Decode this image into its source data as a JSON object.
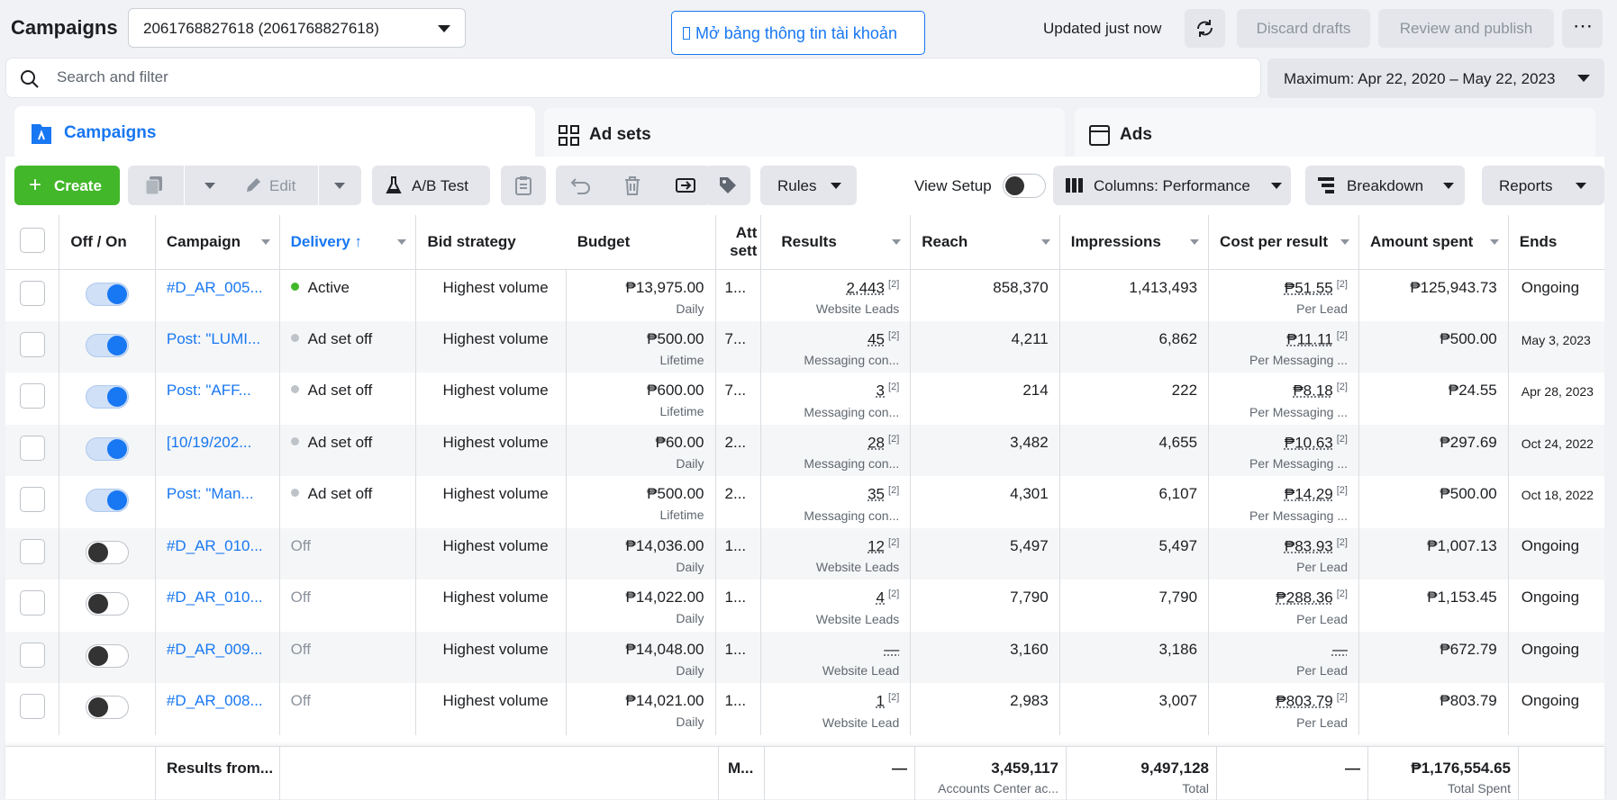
{
  "header": {
    "title": "Campaigns",
    "account_select": "2061768827618 (2061768827618)",
    "open_info_label": "Mở bảng thông tin tài khoản",
    "updated_text": "Updated just now",
    "discard_label": "Discard drafts",
    "review_label": "Review and publish"
  },
  "search": {
    "placeholder": "Search and filter"
  },
  "date_range": "Maximum: Apr 22, 2020 – May 22, 2023",
  "tabs": [
    {
      "label": "Campaigns",
      "icon": "campaign-flag-icon"
    },
    {
      "label": "Ad sets",
      "icon": "grid-icon"
    },
    {
      "label": "Ads",
      "icon": "ad-window-icon"
    }
  ],
  "toolbar": {
    "create_label": "Create",
    "edit_label": "Edit",
    "abtest_label": "A/B Test",
    "rules_label": "Rules",
    "view_setup_label": "View Setup",
    "columns_label": "Columns: Performance",
    "breakdown_label": "Breakdown",
    "reports_label": "Reports"
  },
  "columns": [
    "Off / On",
    "Campaign",
    "Delivery ↑",
    "Bid strategy",
    "Budget",
    "Att sett",
    "Results",
    "Reach",
    "Impressions",
    "Cost per result",
    "Amount spent",
    "Ends"
  ],
  "rows": [
    {
      "on": true,
      "campaign": "#D_AR_005...",
      "delivery": "Active",
      "status": "active",
      "bid": "Highest volume",
      "budget": "₱13,975.00",
      "budget_type": "Daily",
      "att": "1...",
      "results": "2,443",
      "results_type": "Website Leads",
      "reach": "858,370",
      "impressions": "1,413,493",
      "cpr": "₱51.55",
      "cpr_type": "Per Lead",
      "spent": "₱125,943.73",
      "ends": "Ongoing"
    },
    {
      "on": true,
      "campaign": "Post: \"LUMI...",
      "delivery": "Ad set off",
      "status": "adsetoff",
      "bid": "Highest volume",
      "budget": "₱500.00",
      "budget_type": "Lifetime",
      "att": "7...",
      "results": "45",
      "results_type": "Messaging con...",
      "reach": "4,211",
      "impressions": "6,862",
      "cpr": "₱11.11",
      "cpr_type": "Per Messaging ...",
      "spent": "₱500.00",
      "ends": "May 3, 2023"
    },
    {
      "on": true,
      "campaign": "Post: \"AFF...",
      "delivery": "Ad set off",
      "status": "adsetoff",
      "bid": "Highest volume",
      "budget": "₱600.00",
      "budget_type": "Lifetime",
      "att": "7...",
      "results": "3",
      "results_type": "Messaging con...",
      "reach": "214",
      "impressions": "222",
      "cpr": "₱8.18",
      "cpr_type": "Per Messaging ...",
      "spent": "₱24.55",
      "ends": "Apr 28, 2023"
    },
    {
      "on": true,
      "campaign": "[10/19/202...",
      "delivery": "Ad set off",
      "status": "adsetoff",
      "bid": "Highest volume",
      "budget": "₱60.00",
      "budget_type": "Daily",
      "att": "2...",
      "results": "28",
      "results_type": "Messaging con...",
      "reach": "3,482",
      "impressions": "4,655",
      "cpr": "₱10.63",
      "cpr_type": "Per Messaging ...",
      "spent": "₱297.69",
      "ends": "Oct 24, 2022"
    },
    {
      "on": true,
      "campaign": "Post: \"Man...",
      "delivery": "Ad set off",
      "status": "adsetoff",
      "bid": "Highest volume",
      "budget": "₱500.00",
      "budget_type": "Lifetime",
      "att": "2...",
      "results": "35",
      "results_type": "Messaging con...",
      "reach": "4,301",
      "impressions": "6,107",
      "cpr": "₱14.29",
      "cpr_type": "Per Messaging ...",
      "spent": "₱500.00",
      "ends": "Oct 18, 2022"
    },
    {
      "on": false,
      "campaign": "#D_AR_010...",
      "delivery": "Off",
      "status": "off",
      "bid": "Highest volume",
      "budget": "₱14,036.00",
      "budget_type": "Daily",
      "att": "1...",
      "results": "12",
      "results_type": "Website Leads",
      "reach": "5,497",
      "impressions": "5,497",
      "cpr": "₱83.93",
      "cpr_type": "Per Lead",
      "spent": "₱1,007.13",
      "ends": "Ongoing"
    },
    {
      "on": false,
      "campaign": "#D_AR_010...",
      "delivery": "Off",
      "status": "off",
      "bid": "Highest volume",
      "budget": "₱14,022.00",
      "budget_type": "Daily",
      "att": "1...",
      "results": "4",
      "results_type": "Website Leads",
      "reach": "7,790",
      "impressions": "7,790",
      "cpr": "₱288.36",
      "cpr_type": "Per Lead",
      "spent": "₱1,153.45",
      "ends": "Ongoing"
    },
    {
      "on": false,
      "campaign": "#D_AR_009...",
      "delivery": "Off",
      "status": "off",
      "bid": "Highest volume",
      "budget": "₱14,048.00",
      "budget_type": "Daily",
      "att": "1...",
      "results": "—",
      "results_type": "Website Lead",
      "reach": "3,160",
      "impressions": "3,186",
      "cpr": "—",
      "cpr_type": "Per Lead",
      "spent": "₱672.79",
      "ends": "Ongoing"
    },
    {
      "on": false,
      "campaign": "#D_AR_008...",
      "delivery": "Off",
      "status": "off",
      "bid": "Highest volume",
      "budget": "₱14,021.00",
      "budget_type": "Daily",
      "att": "1...",
      "results": "1",
      "results_type": "Website Lead",
      "reach": "2,983",
      "impressions": "3,007",
      "cpr": "₱803.79",
      "cpr_type": "Per Lead",
      "spent": "₱803.79",
      "ends": "Ongoing"
    }
  ],
  "footer": {
    "label": "Results from...",
    "att": "M...",
    "results": "—",
    "reach": "3,459,117",
    "reach_sub": "Accounts Center ac...",
    "impressions": "9,497,128",
    "impressions_sub": "Total",
    "cpr": "—",
    "spent": "₱1,176,554.65",
    "spent_sub": "Total Spent"
  }
}
